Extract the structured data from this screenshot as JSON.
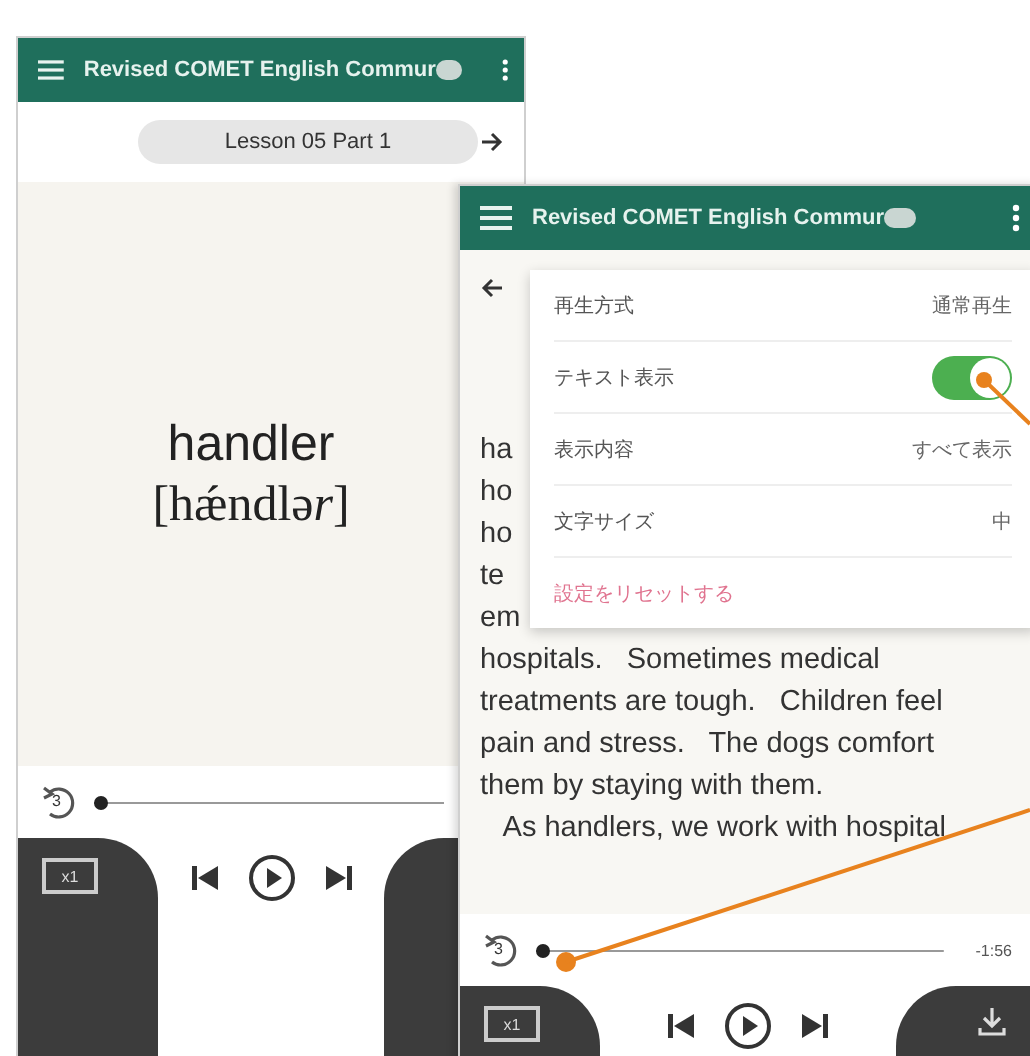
{
  "back_screen": {
    "title": "Revised COMET English Commur",
    "lesson": "Lesson 05 Part 1",
    "word": "handler",
    "pronunciation": [
      {
        "text": "[hǽndlə",
        "italic": false
      },
      {
        "text": "r",
        "italic": true
      },
      {
        "text": "]",
        "italic": false
      }
    ],
    "player": {
      "replay_seconds": "3",
      "level": 0,
      "speed": "x1"
    }
  },
  "front_screen": {
    "title": "Revised COMET English Commur",
    "settings": [
      {
        "kind": "value",
        "label": "再生方式",
        "value": "通常再生"
      },
      {
        "kind": "toggle",
        "label": "テキスト表示",
        "on": true
      },
      {
        "kind": "value",
        "label": "表示内容",
        "value": "すべて表示"
      },
      {
        "kind": "value",
        "label": "文字サイズ",
        "value": "中"
      },
      {
        "kind": "action",
        "label": "設定をリセットする"
      }
    ],
    "text_lines": [
      "ha",
      "ho",
      "ho",
      "te",
      "em",
      "hospitals.   Sometimes medical",
      "treatments are tough.   Children feel",
      "pain and stress.   The dogs comfort",
      "them by staying with them.",
      "   As handlers, we work with hospital"
    ],
    "player": {
      "replay_seconds": "3",
      "level": 0,
      "time": "-1:56",
      "speed": "x1"
    }
  }
}
